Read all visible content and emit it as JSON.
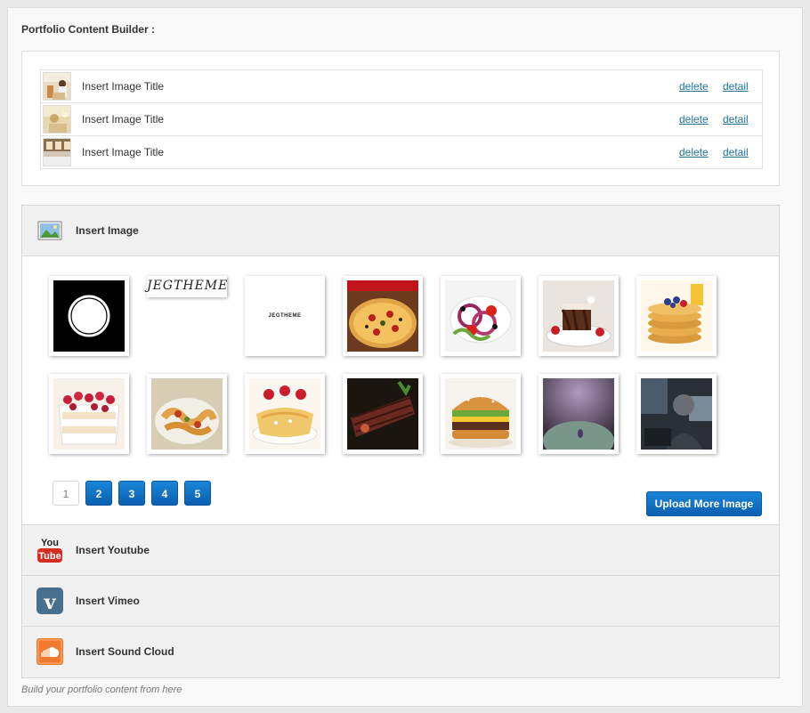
{
  "builder": {
    "title": "Portfolio Content Builder :"
  },
  "items": [
    {
      "title": "Insert Image Title",
      "delete": "delete",
      "detail": "detail"
    },
    {
      "title": "Insert Image Title",
      "delete": "delete",
      "detail": "detail"
    },
    {
      "title": "Insert Image Title",
      "delete": "delete",
      "detail": "detail"
    }
  ],
  "sections": {
    "image": {
      "label": "Insert Image",
      "icon": "image-icon"
    },
    "youtube": {
      "label": "Insert Youtube",
      "icon": "youtube-icon",
      "icon_top": "You",
      "icon_bottom": "Tube"
    },
    "vimeo": {
      "label": "Insert Vimeo",
      "icon": "vimeo-icon",
      "icon_text": "v"
    },
    "soundcloud": {
      "label": "Insert Sound Cloud",
      "icon": "soundcloud-icon"
    }
  },
  "gallery": {
    "logo_text": "JEGTHEME",
    "logo_small_text": "JEGTHEME",
    "images": [
      "circle-logo",
      "jegtheme-script-logo",
      "jegtheme-logo",
      "pizza",
      "salad",
      "chocolate-cake",
      "pancakes",
      "raspberry-cake",
      "pasta",
      "crepes",
      "steak",
      "burger",
      "blurry-purple",
      "person-at-computer"
    ]
  },
  "pagination": {
    "pages": [
      "1",
      "2",
      "3",
      "4",
      "5"
    ],
    "current": "1"
  },
  "upload_label": "Upload More Image",
  "footer": "Build your portfolio content from here",
  "colors": {
    "link": "#21759b",
    "button": "#0b6fc4",
    "youtube_red": "#d62d20",
    "vimeo_blue": "#4a6f8c",
    "soundcloud_orange": "#f07b2e"
  }
}
